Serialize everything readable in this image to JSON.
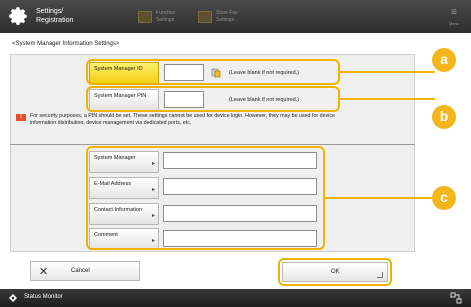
{
  "header": {
    "title": "Settings/ Registration",
    "tab1": "Function Settings",
    "tab2": "Store Fax Settings",
    "menu_label": "Menu",
    "menu_icon": "hamburger-icon",
    "settings_icon": "gear-icon"
  },
  "breadcrumb": "<System Manager Information Settings>",
  "fields": {
    "system_manager_id": {
      "label": "System Manager ID",
      "value": "",
      "hint": "(Leave blank if not required.)"
    },
    "system_manager_pin": {
      "label": "System Manager PIN",
      "value": "",
      "hint": "(Leave blank if not required.)"
    },
    "system_manager": {
      "label": "System Manager",
      "value": ""
    },
    "email": {
      "label": "E-Mail Address",
      "value": ""
    },
    "contact": {
      "label": "Contact Information",
      "value": ""
    },
    "comment": {
      "label": "Comment",
      "value": ""
    }
  },
  "warning": "For security purposes, a PIN should be set. These settings cannot be used for device login. However, they may be used for device information distribution, device management via dedicated ports, etc.",
  "callouts": [
    "a",
    "b",
    "c"
  ],
  "buttons": {
    "cancel": "Cancel",
    "ok": "OK"
  },
  "status": {
    "label": "Status Monitor"
  },
  "colors": {
    "accent": "#f3b51a",
    "active_field": "#f2cf12",
    "warning": "#e8502a"
  }
}
